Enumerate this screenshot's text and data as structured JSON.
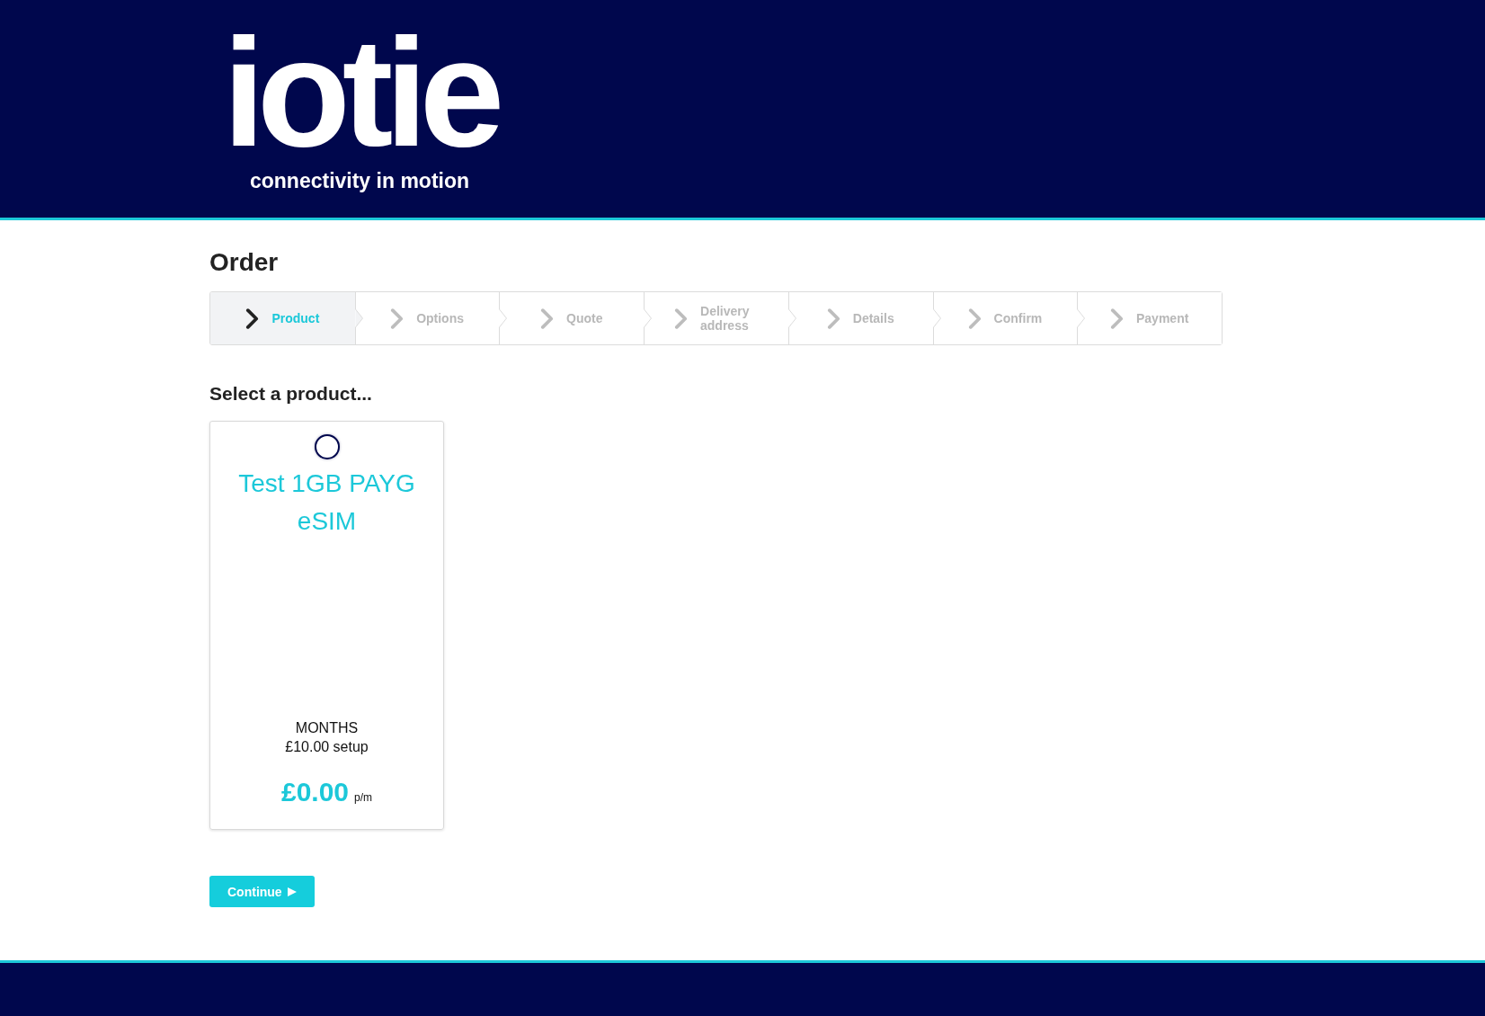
{
  "logo": {
    "wordmark": "iotie",
    "tagline": "connectivity in motion"
  },
  "page_title": "Order",
  "steps": [
    {
      "label": "Product",
      "selected": true
    },
    {
      "label": "Options",
      "selected": false
    },
    {
      "label": "Quote",
      "selected": false
    },
    {
      "label": "Delivery address",
      "selected": false
    },
    {
      "label": "Details",
      "selected": false
    },
    {
      "label": "Confirm",
      "selected": false
    },
    {
      "label": "Payment",
      "selected": false
    }
  ],
  "section_title": "Select a product...",
  "products": [
    {
      "name": "Test 1GB PAYG eSIM",
      "selected": false,
      "term": "MONTHS",
      "setup": "£10.00 setup",
      "price": "£0.00",
      "price_unit": "p/m"
    }
  ],
  "continue_button": {
    "label": "Continue"
  }
}
